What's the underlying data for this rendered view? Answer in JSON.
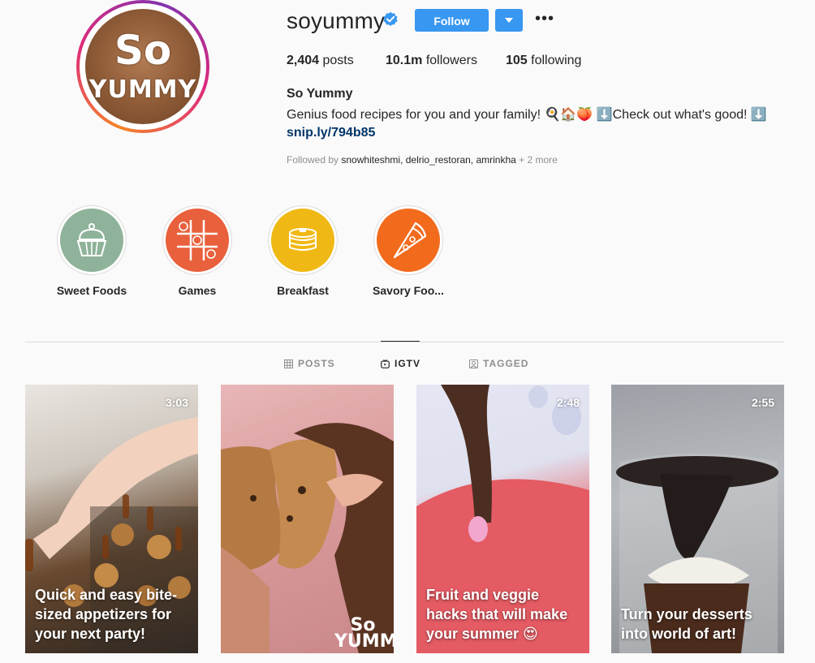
{
  "profile": {
    "username": "soyummy",
    "follow_label": "Follow",
    "stats": {
      "posts_count": "2,404",
      "posts_label": "posts",
      "followers_count": "10.1m",
      "followers_label": "followers",
      "following_count": "105",
      "following_label": "following"
    },
    "full_name": "So Yummy",
    "bio": "Genius food recipes for you and your family! 🍳🏠🍑 ⬇️Check out what's good! ⬇️",
    "link": "snip.ly/794b85",
    "followed_by_prefix": "Followed by",
    "followed_by_names": "snowhiteshmi, delrio_restoran, amrinkha",
    "followed_by_more": "+ 2 more",
    "avatar_text_line1": "So",
    "avatar_text_line2": "YUMMY"
  },
  "highlights": [
    {
      "label": "Sweet Foods",
      "icon": "cupcake-icon",
      "color": "#8fb39a"
    },
    {
      "label": "Games",
      "icon": "tic-tac-toe-icon",
      "color": "#e8603c"
    },
    {
      "label": "Breakfast",
      "icon": "pancakes-icon",
      "color": "#f0b814"
    },
    {
      "label": "Savory Foo...",
      "icon": "pizza-slice-icon",
      "color": "#f26b1d"
    }
  ],
  "tabs": [
    {
      "label": "POSTS",
      "icon": "grid-icon",
      "active": false
    },
    {
      "label": "IGTV",
      "icon": "igtv-icon",
      "active": true
    },
    {
      "label": "TAGGED",
      "icon": "tagged-icon",
      "active": false
    }
  ],
  "videos": [
    {
      "duration": "3:03",
      "caption": "Quick and easy bite-sized appetizers for your next party!"
    },
    {
      "duration": "",
      "caption": "",
      "watermark": "So YUMMY"
    },
    {
      "duration": "2:48",
      "caption": "Fruit and veggie hacks that will make your summer 😍"
    },
    {
      "duration": "2:55",
      "caption": "Turn your desserts into world of art!"
    }
  ],
  "colors": {
    "accent": "#3897f0",
    "link": "#003569",
    "muted": "#8e8e8e",
    "text": "#262626"
  }
}
